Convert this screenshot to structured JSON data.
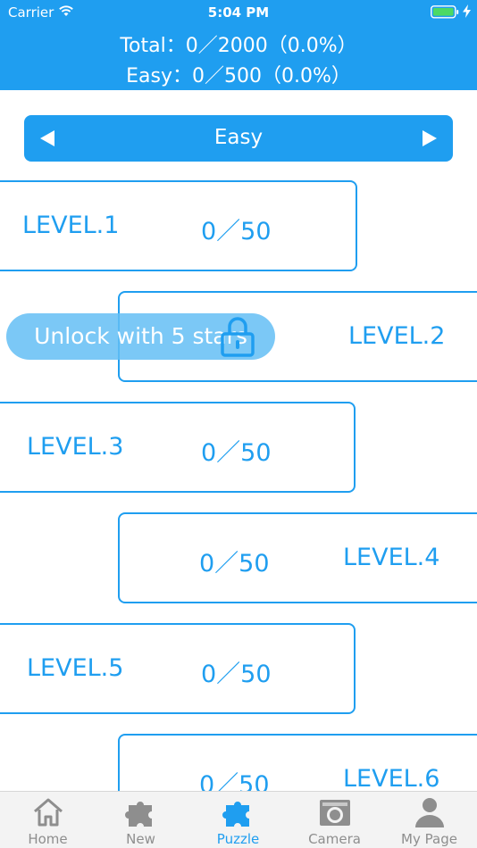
{
  "status_bar": {
    "carrier": "Carrier",
    "time": "5:04 PM"
  },
  "header": {
    "total_line": "Total：0／2000（0.0%）",
    "easy_line": "Easy：0／500（0.0%）"
  },
  "selector": {
    "label": "Easy",
    "prev_icon": "triangle-left-icon",
    "next_icon": "triangle-right-icon"
  },
  "levels": [
    {
      "name": "LEVEL.1",
      "score": "0／50"
    },
    {
      "name": "LEVEL.2",
      "score": ""
    },
    {
      "name": "LEVEL.3",
      "score": "0／50"
    },
    {
      "name": "LEVEL.4",
      "score": "0／50"
    },
    {
      "name": "LEVEL.5",
      "score": "0／50"
    },
    {
      "name": "LEVEL.6",
      "score": "0／50"
    }
  ],
  "unlock": {
    "label": "Unlock with 5 stars",
    "icon": "lock-icon"
  },
  "tabs": [
    {
      "label": "Home",
      "icon": "home-icon"
    },
    {
      "label": "New",
      "icon": "puzzle-piece-icon"
    },
    {
      "label": "Puzzle",
      "icon": "puzzle-piece-icon",
      "active": true
    },
    {
      "label": "Camera",
      "icon": "camera-icon"
    },
    {
      "label": "My Page",
      "icon": "person-icon"
    }
  ],
  "colors": {
    "accent": "#1f9ef0",
    "tab_inactive": "#8e8e8e",
    "tabbar_bg": "#f3f3f3"
  }
}
